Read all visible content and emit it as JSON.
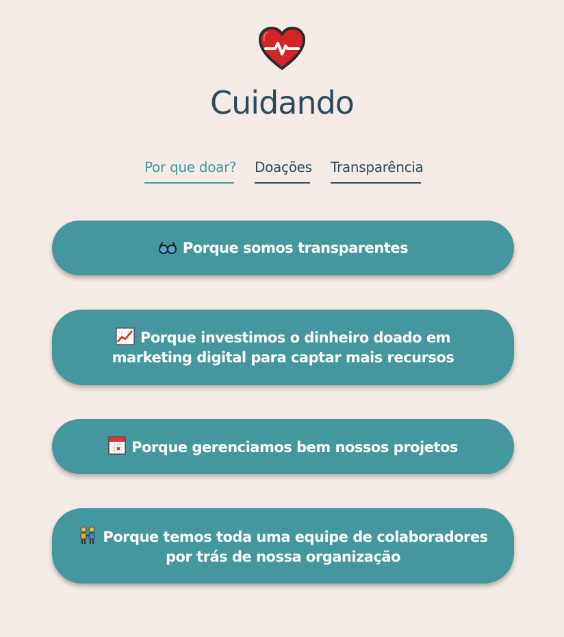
{
  "header": {
    "title": "Cuidando",
    "logo_icon": "heart-pulse-icon"
  },
  "nav": {
    "items": [
      {
        "label": "Por que doar?",
        "active": true
      },
      {
        "label": "Doações",
        "active": false
      },
      {
        "label": "Transparência",
        "active": false
      }
    ]
  },
  "reasons": [
    {
      "icon": "glasses-icon",
      "text": "Porque somos transparentes"
    },
    {
      "icon": "chart-increasing-icon",
      "text": "Porque investimos o dinheiro doado em marketing digital para captar mais recursos"
    },
    {
      "icon": "calendar-icon",
      "text": "Porque gerenciamos bem nossos projetos"
    },
    {
      "icon": "people-holding-hands-icon",
      "text": "Porque temos toda uma equipe de colaboradores por trás de nossa organização"
    }
  ],
  "colors": {
    "background": "#f4ebe6",
    "primary": "#44979e",
    "text_dark": "#2d4a5c",
    "heart": "#d42427"
  }
}
